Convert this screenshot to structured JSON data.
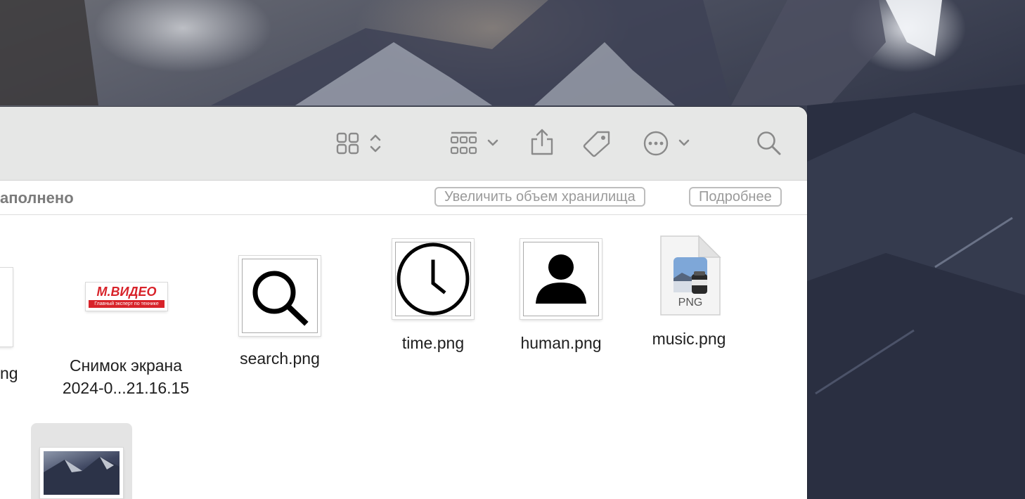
{
  "toolbar": {
    "icons": [
      "view-grid-icon",
      "chevron-updown-icon",
      "group-icon",
      "chevron-down-icon",
      "share-icon",
      "tag-icon",
      "more-icon",
      "chevron-down-icon",
      "search-icon"
    ]
  },
  "storage": {
    "status_text": "аполнено",
    "increase_button": "Увеличить объем хранилища",
    "details_button": "Подробнее"
  },
  "files": [
    {
      "name": "ng"
    },
    {
      "name_line1": "Снимок экрана",
      "name_line2": "2024-0...21.16.15",
      "thumb_brand": "М.ВИДЕО",
      "thumb_tagline": "Главный эксперт по технике"
    },
    {
      "name": "search.png"
    },
    {
      "name": "time.png"
    },
    {
      "name": "human.png"
    },
    {
      "name": "music.png",
      "badge": "PNG"
    }
  ],
  "colors": {
    "toolbar_bg": "#e6e7e6",
    "brand_red": "#d8232a",
    "selection_bg": "#e4e4e4"
  }
}
